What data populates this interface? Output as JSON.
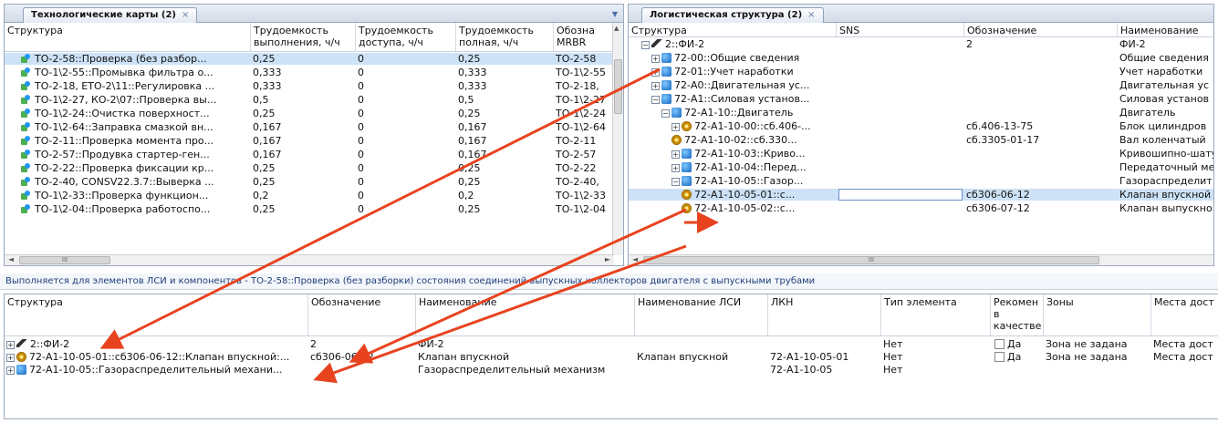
{
  "left_panel": {
    "tab_title": "Технологические карты (2)",
    "columns": [
      "Структура",
      "Трудоемкость выполнения, ч/ч",
      "Трудоемкость доступа, ч/ч",
      "Трудоемкость полная, ч/ч",
      "Обозначение MRBR"
    ],
    "col_line1": [
      "Структура",
      "Трудоемкость",
      "Трудоемкость",
      "Трудоемкость",
      "Обозна"
    ],
    "col_line2": [
      "",
      "выполнения, ч/ч",
      "доступа, ч/ч",
      "полная, ч/ч",
      "MRBR"
    ],
    "rows": [
      {
        "name": "ТО-2-58::Проверка (без разбор...",
        "exec": "0,25",
        "access": "0",
        "full": "0,25",
        "mrbr": "ТО-2-58"
      },
      {
        "name": "ТО-1\\2-55::Промывка фильтра о...",
        "exec": "0,333",
        "access": "0",
        "full": "0,333",
        "mrbr": "ТО-1\\2-55"
      },
      {
        "name": "ТО-2-18, ЕТО-2\\11::Регулировка ...",
        "exec": "0,333",
        "access": "0",
        "full": "0,333",
        "mrbr": "ТО-2-18,"
      },
      {
        "name": "ТО-1\\2-27, КО-2\\07::Проверка вы...",
        "exec": "0,5",
        "access": "0",
        "full": "0,5",
        "mrbr": "ТО-1\\2-27"
      },
      {
        "name": "ТО-1\\2-24::Очистка поверхност...",
        "exec": "0,25",
        "access": "0",
        "full": "0,25",
        "mrbr": "ТО-1\\2-24"
      },
      {
        "name": "ТО-1\\2-64::Заправка смазкой вн...",
        "exec": "0,167",
        "access": "0",
        "full": "0,167",
        "mrbr": "ТО-1\\2-64"
      },
      {
        "name": "ТО-2-11::Проверка момента про...",
        "exec": "0,167",
        "access": "0",
        "full": "0,167",
        "mrbr": "ТО-2-11"
      },
      {
        "name": "ТО-2-57::Продувка стартер-ген...",
        "exec": "0,167",
        "access": "0",
        "full": "0,167",
        "mrbr": "ТО-2-57"
      },
      {
        "name": "ТО-2-22::Проверка фиксации кр...",
        "exec": "0,25",
        "access": "0",
        "full": "0,25",
        "mrbr": "ТО-2-22"
      },
      {
        "name": "ТО-2-40, CONSV22.3.7::Выверка ...",
        "exec": "0,25",
        "access": "0",
        "full": "0,25",
        "mrbr": "ТО-2-40,"
      },
      {
        "name": "ТО-1\\2-33::Проверка функцион...",
        "exec": "0,2",
        "access": "0",
        "full": "0,2",
        "mrbr": "ТО-1\\2-33"
      },
      {
        "name": "ТО-1\\2-04::Проверка работоспо...",
        "exec": "0,25",
        "access": "0",
        "full": "0,25",
        "mrbr": "ТО-1\\2-04"
      }
    ]
  },
  "right_panel": {
    "tab_title": "Логистическая структура (2)",
    "columns": [
      "Структура",
      "SNS",
      "Обозначение",
      "Наименование"
    ],
    "rows": [
      {
        "name": "2::ФИ-2",
        "code": "2",
        "title": "ФИ-2"
      },
      {
        "name": "72-00::Общие сведения",
        "code": "",
        "title": "Общие сведения"
      },
      {
        "name": "72-01::Учет наработки",
        "code": "",
        "title": "Учет наработки"
      },
      {
        "name": "72-А0::Двигательная ус...",
        "code": "",
        "title": "Двигательная ус"
      },
      {
        "name": "72-А1::Силовая установ...",
        "code": "",
        "title": "Силовая установ"
      },
      {
        "name": "72-А1-10::Двигатель",
        "code": "",
        "title": "Двигатель"
      },
      {
        "name": "72-А1-10-00::сб.406-...",
        "code": "сб.406-13-75",
        "title": "Блок цилиндров"
      },
      {
        "name": "72-А1-10-02::сб.330...",
        "code": "сб.3305-01-17",
        "title": "Вал коленчатый"
      },
      {
        "name": "72-А1-10-03::Криво...",
        "code": "",
        "title": "Кривошипно-шату"
      },
      {
        "name": "72-А1-10-04::Перед...",
        "code": "",
        "title": "Передаточный ме"
      },
      {
        "name": "72-А1-10-05::Газор...",
        "code": "",
        "title": "Газораспределит"
      },
      {
        "name": "72-А1-10-05-01::с...",
        "code": "сб306-06-12",
        "title": "Клапан впускной"
      },
      {
        "name": "72-А1-10-05-02::с...",
        "code": "сб306-07-12",
        "title": "Клапан выпускно"
      }
    ]
  },
  "info_bar": "Выполняется для элементов ЛСИ и компонентов - ТО-2-58::Проверка (без разборки) состояния соединений выпускных коллекторов двигателя с выпускными трубами",
  "bottom_panel": {
    "columns": [
      "Структура",
      "Обозначение",
      "Наименование",
      "Наименование ЛСИ",
      "ЛКН",
      "Тип элемента",
      "Рекомен в качестве",
      "Зоны",
      "Места дост"
    ],
    "rec_col_lines": [
      "Рекомен",
      "в",
      "качестве"
    ],
    "check_label": "Да",
    "rows": [
      {
        "name": "2::ФИ-2",
        "code": "2",
        "title": "ФИ-2",
        "lsi": "",
        "lkn": "",
        "type": "Нет",
        "rec": "",
        "zones": "",
        "places": ""
      },
      {
        "name": "72-А1-10-05-01::сб306-06-12::Клапан впускной:...",
        "code": "сб306-06-12",
        "title": "Клапан впускной",
        "lsi": "Клапан впускной",
        "lkn": "72-А1-10-05-01",
        "type": "Нет",
        "rec": "Да",
        "zones": "Зона не задана",
        "places": "Места дост"
      },
      {
        "name": "72-А1-10-05::Газораспределительный механи...",
        "code": "",
        "title": "Газораспределительный механизм",
        "lsi": "",
        "lkn": "72-А1-10-05",
        "type": "Нет",
        "rec": "",
        "zones": "",
        "places": ""
      }
    ]
  },
  "scroll_arrow_left": "◄",
  "scroll_arrow_right": "►",
  "scroll_grip": "III",
  "scroll_up": "▲",
  "tab_close": "×",
  "tab_dropdown": "▼",
  "expand_glyph": "+",
  "collapse_glyph": "−",
  "colors": {
    "accent": "#e8431f",
    "selection": "#cde2f6",
    "header_text": "#1f3f7a"
  }
}
